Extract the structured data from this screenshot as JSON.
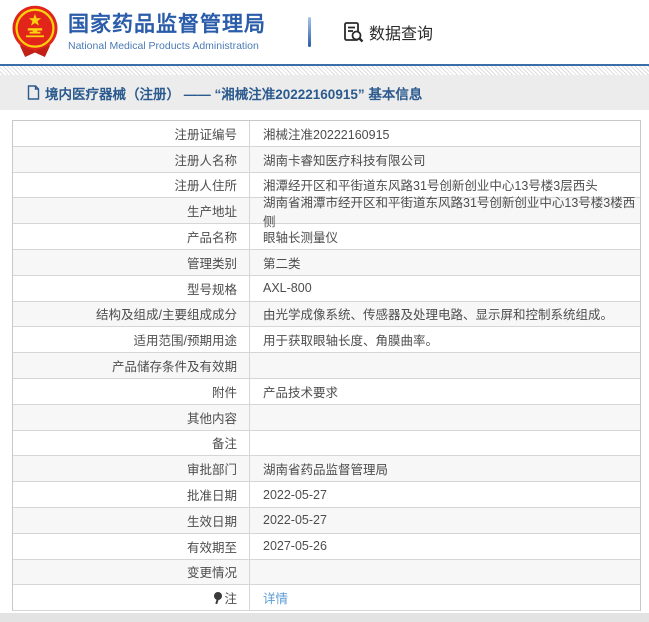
{
  "header": {
    "title": "国家药品监督管理局",
    "subtitle": "National Medical Products Administration",
    "nav_label": "数据查询"
  },
  "breadcrumb": {
    "text": "境内医疗器械（注册） —— “湘械注准20222160915” 基本信息"
  },
  "table": {
    "rows": [
      {
        "label": "注册证编号",
        "value": "湘械注准20222160915"
      },
      {
        "label": "注册人名称",
        "value": "湖南卡睿知医疗科技有限公司"
      },
      {
        "label": "注册人住所",
        "value": "湘潭经开区和平街道东风路31号创新创业中心13号楼3层西头"
      },
      {
        "label": "生产地址",
        "value": "湖南省湘潭市经开区和平街道东风路31号创新创业中心13号楼3楼西侧"
      },
      {
        "label": "产品名称",
        "value": "眼轴长测量仪"
      },
      {
        "label": "管理类别",
        "value": "第二类"
      },
      {
        "label": "型号规格",
        "value": "AXL-800"
      },
      {
        "label": "结构及组成/主要组成成分",
        "value": "由光学成像系统、传感器及处理电路、显示屏和控制系统组成。"
      },
      {
        "label": "适用范围/预期用途",
        "value": "用于获取眼轴长度、角膜曲率。"
      },
      {
        "label": "产品储存条件及有效期",
        "value": ""
      },
      {
        "label": "附件",
        "value": "产品技术要求"
      },
      {
        "label": "其他内容",
        "value": ""
      },
      {
        "label": "备注",
        "value": ""
      },
      {
        "label": "审批部门",
        "value": "湖南省药品监督管理局"
      },
      {
        "label": "批准日期",
        "value": "2022-05-27"
      },
      {
        "label": "生效日期",
        "value": "2022-05-27"
      },
      {
        "label": "有效期至",
        "value": "2027-05-26"
      },
      {
        "label": "变更情况",
        "value": ""
      },
      {
        "label": "注",
        "value": "详情",
        "link": true,
        "note_icon": true
      }
    ]
  },
  "colors": {
    "brand_blue": "#2a5caa",
    "breadcrumb_text": "#2b5a8e",
    "link_blue": "#5b9bd5",
    "emblem_red": "#e1251b",
    "emblem_gold": "#fbd00e",
    "row_alt_bg": "#f7f7f7",
    "table_border": "#c8c8c8"
  },
  "icons": {
    "nav_icon": "document-search-icon",
    "breadcrumb_icon": "document-icon",
    "note_icon": "note-pin-icon"
  }
}
